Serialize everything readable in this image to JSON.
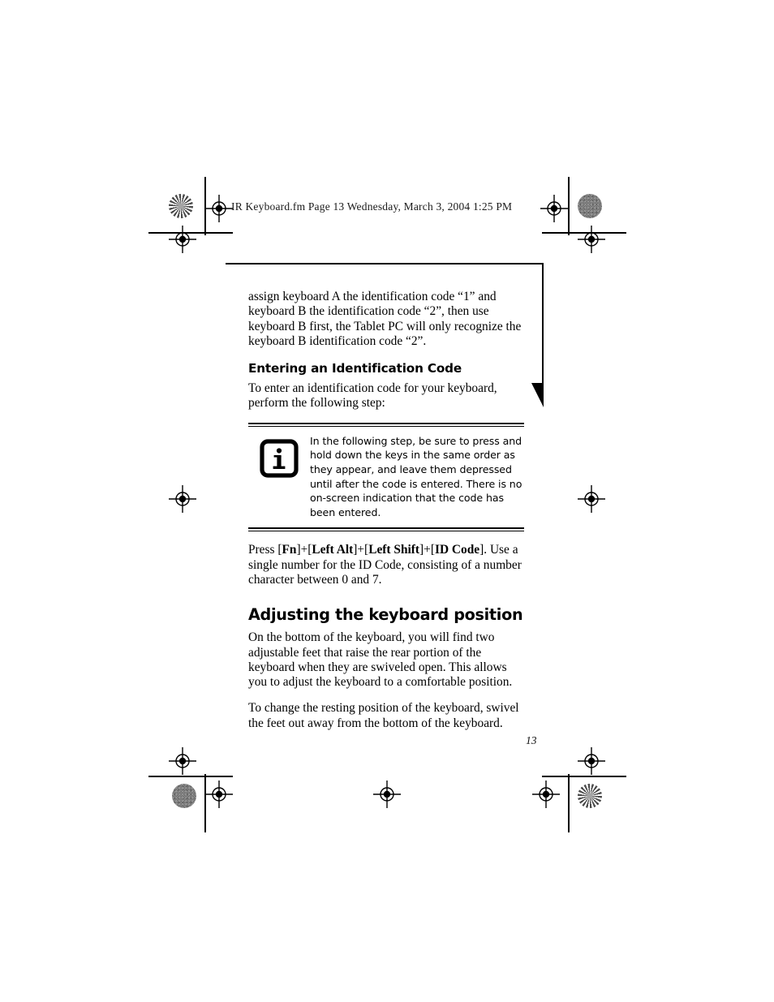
{
  "document": {
    "header_slug": "IR Keyboard.fm  Page 13  Wednesday, March 3, 2004  1:25 PM",
    "page_number": "13"
  },
  "content": {
    "intro_paragraph": "assign keyboard A the identification code “1” and keyboard B the identification code “2”, then use keyboard B first, the Tablet PC will only recognize the keyboard B identification code “2”.",
    "sub_heading": "Entering an Identification Code",
    "sub_heading_paragraph": "To enter an identification code for your keyboard, perform the following step:",
    "note": {
      "icon_label": "i",
      "text": "In the following step, be sure to press and hold down the keys in the same order as they appear, and leave them depressed until after the code is entered. There is no on-screen indication that the code has been entered."
    },
    "press_instruction": {
      "lead": "Press [",
      "key1": "Fn",
      "sep1": "]+[",
      "key2": "Left Alt",
      "sep2": "]+[",
      "key3": "Left Shift",
      "sep3": "]+[",
      "key4": "ID Code",
      "tail": "]. Use a single number for the ID Code, consisting of a number character between 0 and 7."
    },
    "main_heading": "Adjusting the keyboard position",
    "main_paragraph": "On the bottom of the keyboard, you will find two adjustable feet that raise the rear portion of the keyboard when they are swiveled open. This allows you to adjust the keyboard to a comfortable position.",
    "closing_paragraph": "To change the resting position of the keyboard, swivel the feet out away from the bottom of the keyboard."
  },
  "marks": {
    "registration_name": "registration-crosshair",
    "halftone_name": "halftone-density-patch",
    "colors": {
      "ink": "#000000",
      "paper": "#ffffff"
    }
  }
}
